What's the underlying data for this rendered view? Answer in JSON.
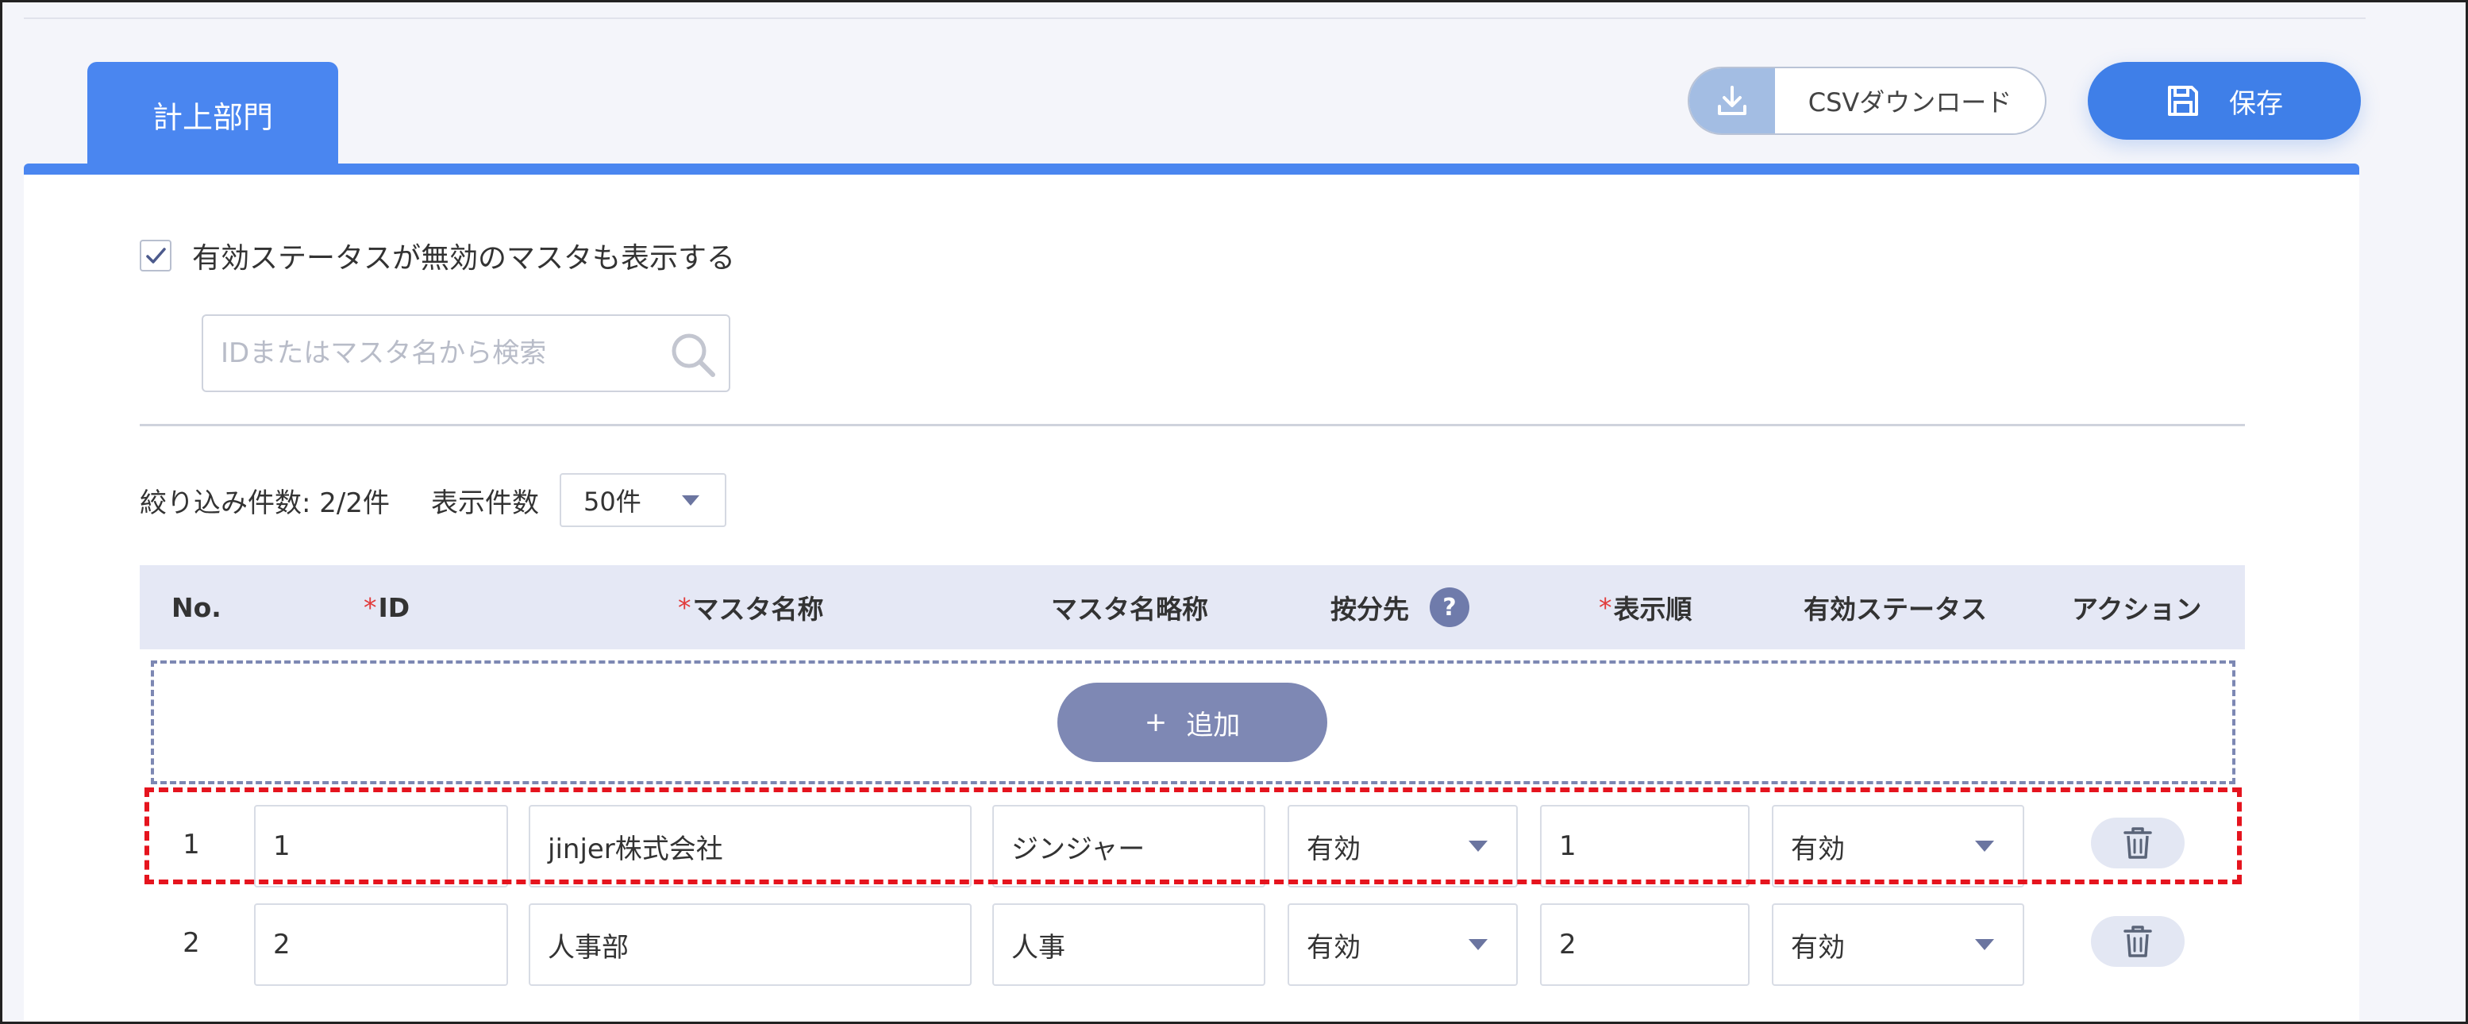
{
  "tab": {
    "label": "計上部門"
  },
  "header": {
    "csv_label": "CSVダウンロード",
    "save_label": "保存"
  },
  "filters": {
    "show_inactive_label": "有効ステータスが無効のマスタも表示する",
    "show_inactive_checked": true,
    "search_placeholder": "IDまたはマスタ名から検索",
    "result_count_label": "絞り込み件数: 2/2件",
    "per_page_label": "表示件数",
    "per_page_value": "50件"
  },
  "table": {
    "columns": {
      "no": "No.",
      "id": "ID",
      "name": "マスタ名称",
      "short_name": "マスタ名略称",
      "allocation": "按分先",
      "order": "表示順",
      "status": "有効ステータス",
      "action": "アクション"
    },
    "required_mark": "*",
    "help_glyph": "?",
    "add_label": "追加",
    "add_glyph": "+",
    "rows": [
      {
        "no": "1",
        "id": "1",
        "name": "jinjer株式会社",
        "short_name": "ジンジャー",
        "allocation": "有効",
        "order": "1",
        "status": "有効"
      },
      {
        "no": "2",
        "id": "2",
        "name": "人事部",
        "short_name": "人事",
        "allocation": "有効",
        "order": "2",
        "status": "有効"
      }
    ]
  },
  "colors": {
    "accent": "#4a86f0",
    "add_button": "#7e88b4",
    "highlight": "#e5141e",
    "header_bg": "#e5e8f5"
  }
}
